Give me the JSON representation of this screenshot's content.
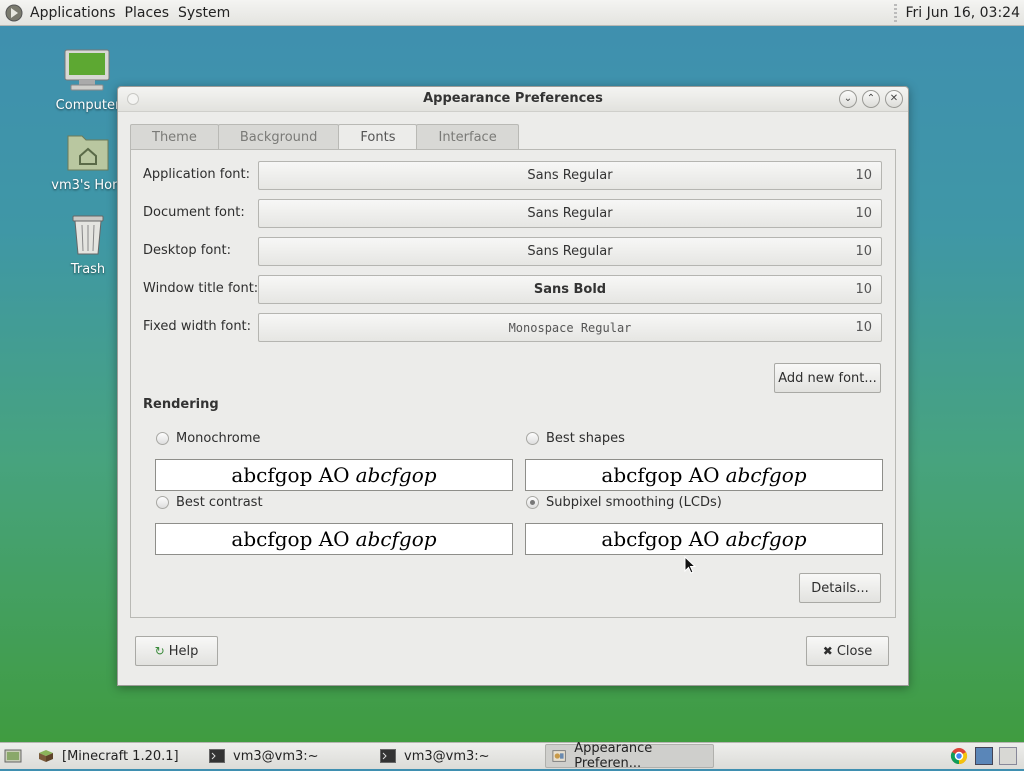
{
  "top_panel": {
    "menus": [
      "Applications",
      "Places",
      "System"
    ],
    "clock": "Fri Jun 16, 03:24"
  },
  "desktop_icons": [
    {
      "label": "Computer",
      "icon": "computer-icon"
    },
    {
      "label": "vm3's Hom",
      "icon": "home-folder-icon"
    },
    {
      "label": "Trash",
      "icon": "trash-icon"
    }
  ],
  "window": {
    "title": "Appearance Preferences",
    "tabs": [
      "Theme",
      "Background",
      "Fonts",
      "Interface"
    ],
    "active_tab": "Fonts",
    "font_rows": [
      {
        "label": "Application font:",
        "font": "Sans Regular",
        "size": "10"
      },
      {
        "label": "Document font:",
        "font": "Sans Regular",
        "size": "10"
      },
      {
        "label": "Desktop font:",
        "font": "Sans Regular",
        "size": "10"
      },
      {
        "label": "Window title font:",
        "font": "Sans Bold",
        "size": "10"
      },
      {
        "label": "Fixed width font:",
        "font": "Monospace Regular",
        "size": "10"
      }
    ],
    "add_font_label": "Add new font...",
    "rendering": {
      "title": "Rendering",
      "options": [
        {
          "label": "Monochrome",
          "selected": false
        },
        {
          "label": "Best shapes",
          "selected": false
        },
        {
          "label": "Best contrast",
          "selected": false
        },
        {
          "label": "Subpixel smoothing (LCDs)",
          "selected": true
        }
      ],
      "sample_regular": "abcfgop AO",
      "sample_italic": "abcfgop"
    },
    "details_label": "Details...",
    "help_label": "Help",
    "close_label": "Close"
  },
  "taskbar": {
    "tasks": [
      "[Minecraft 1.20.1]",
      "vm3@vm3:~",
      "vm3@vm3:~",
      "Appearance Preferen..."
    ]
  },
  "colors": {
    "desktop_top": "#3f8fb0",
    "desktop_bottom": "#3f9b3a",
    "window_bg": "#ececea"
  }
}
